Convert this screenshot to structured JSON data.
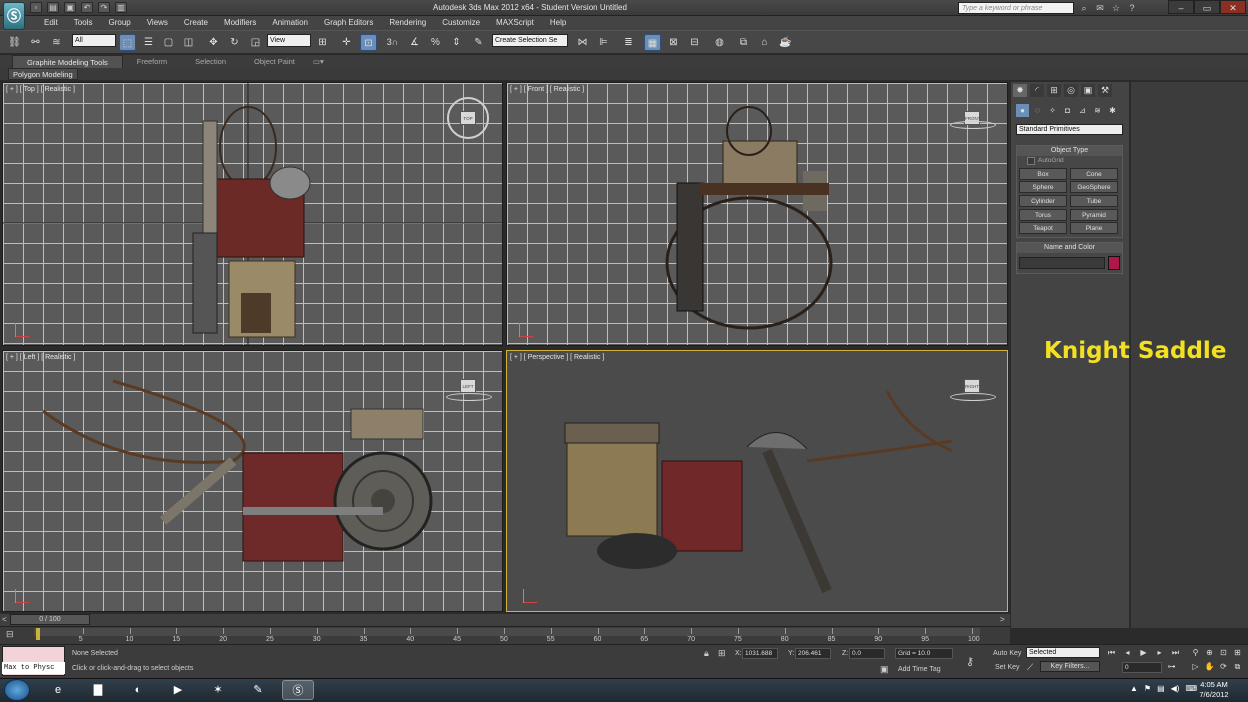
{
  "app": {
    "title": "Autodesk 3ds Max  2012 x64  - Student Version  Untitled",
    "logo": "3ds-max-logo-icon",
    "search_placeholder": "Type a keyword or phrase"
  },
  "menu": [
    "Edit",
    "Tools",
    "Group",
    "Views",
    "Create",
    "Modifiers",
    "Animation",
    "Graph Editors",
    "Rendering",
    "Customize",
    "MAXScript",
    "Help"
  ],
  "toolbar": {
    "selection_filter": "All",
    "ref_coord": "View",
    "named_selection_placeholder": "Create Selection Se",
    "snap_label": "3",
    "accent": "#6c8db5"
  },
  "ribbon": {
    "tabs": [
      "Graphite Modeling Tools",
      "Freeform",
      "Selection",
      "Object Paint"
    ],
    "sub_tab": "Polygon Modeling"
  },
  "viewports": [
    {
      "id": "top",
      "label": "[ + ] [ Top ] [ Realistic ]",
      "cube": "TOP"
    },
    {
      "id": "front",
      "label": "[ + ] [ Front ] [ Realistic ]",
      "cube": "FRONT"
    },
    {
      "id": "left",
      "label": "[ + ] [ Left ] [ Realistic ]",
      "cube": "LEFT"
    },
    {
      "id": "perspective",
      "label": "[ + ] [ Perspective ] [ Realistic ]",
      "cube": "RIGHT"
    }
  ],
  "command_panel": {
    "dropdown": "Standard Primitives",
    "object_type": {
      "title": "Object Type",
      "autogrid": "AutoGrid",
      "buttons": [
        "Box",
        "Cone",
        "Sphere",
        "GeoSphere",
        "Cylinder",
        "Tube",
        "Torus",
        "Pyramid",
        "Teapot",
        "Plane"
      ]
    },
    "name_and_color": {
      "title": "Name and Color",
      "color": "#b0154b"
    }
  },
  "annotation": "Knight Saddle",
  "timeline": {
    "slider": "0 / 100",
    "current": 0,
    "total": 100,
    "ruler": [
      "5",
      "10",
      "15",
      "20",
      "25",
      "30",
      "35",
      "40",
      "45",
      "50",
      "55",
      "60",
      "65",
      "70",
      "75",
      "80",
      "85",
      "90",
      "95",
      "100"
    ]
  },
  "status": {
    "maxscript": "Max to Physc",
    "selection": "None Selected",
    "prompt": "Click or click-and-drag to select objects",
    "x_label": "X:",
    "x": "1031.688",
    "y_label": "Y:",
    "y": "206.461",
    "z_label": "Z:",
    "z": "0.0",
    "grid": "Grid = 10.0",
    "add_time_tag": "Add Time Tag",
    "auto_key": "Auto Key",
    "set_key": "Set Key",
    "key_mode": "Selected",
    "key_filters": "Key Filters...",
    "frame": "0"
  },
  "taskbar": {
    "time": "4:05 AM",
    "date": "7/6/2012"
  }
}
